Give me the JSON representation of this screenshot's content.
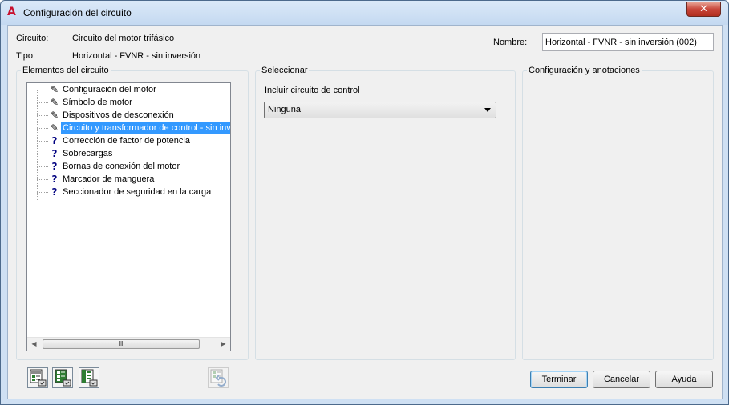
{
  "window": {
    "app_icon_glyph": "A",
    "title": "Configuración del circuito",
    "close_glyph": "✕"
  },
  "header": {
    "circuit_label": "Circuito:",
    "circuit_value": "Circuito del motor trifásico",
    "type_label": "Tipo:",
    "type_value": "Horizontal - FVNR - sin inversión",
    "name_label": "Nombre:",
    "name_value": "Horizontal - FVNR - sin inversión (002)"
  },
  "elements_panel": {
    "title": "Elementos del circuito",
    "items": [
      {
        "label": "Configuración del motor",
        "icon": "pencil-icon",
        "glyph": "✎",
        "selected": false
      },
      {
        "label": "Símbolo de motor",
        "icon": "pencil-icon",
        "glyph": "✎",
        "selected": false
      },
      {
        "label": "Dispositivos de desconexión",
        "icon": "pencil-icon",
        "glyph": "✎",
        "selected": false
      },
      {
        "label": "Circuito y transformador de control - sin inversión",
        "icon": "pencil-icon",
        "glyph": "✎",
        "selected": true
      },
      {
        "label": "Corrección de factor de potencia",
        "icon": "question-icon",
        "glyph": "?",
        "selected": false
      },
      {
        "label": "Sobrecargas",
        "icon": "question-icon",
        "glyph": "?",
        "selected": false
      },
      {
        "label": "Bornas de conexión del motor",
        "icon": "question-icon",
        "glyph": "?",
        "selected": false
      },
      {
        "label": "Marcador de manguera",
        "icon": "question-icon",
        "glyph": "?",
        "selected": false
      },
      {
        "label": "Seccionador de seguridad en la carga",
        "icon": "question-icon",
        "glyph": "?",
        "selected": false
      }
    ],
    "scroll_left_glyph": "◀",
    "scroll_right_glyph": "▶",
    "scroll_thumb_glyph": "Ⅲ"
  },
  "select_panel": {
    "title": "Seleccionar",
    "field_label": "Incluir circuito de control",
    "dropdown_value": "Ninguna"
  },
  "config_panel": {
    "title": "Configuración y anotaciones"
  },
  "buttons": {
    "finish": "Terminar",
    "cancel": "Cancelar",
    "help": "Ayuda"
  },
  "colors": {
    "selection": "#3399ff",
    "window_frame": "#cfe0f3",
    "dialog_bg": "#f0f0f0"
  }
}
